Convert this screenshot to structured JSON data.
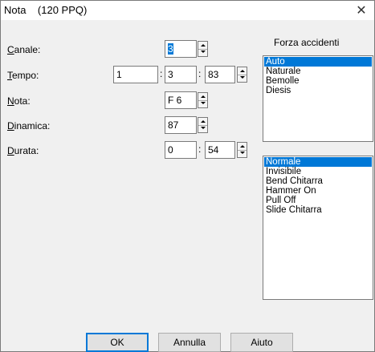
{
  "window": {
    "title": "Nota    (120 PPQ)",
    "close_glyph": "✕"
  },
  "fields": {
    "canale": {
      "label_u": "C",
      "label_rest": "anale:",
      "value": "3"
    },
    "tempo": {
      "label_u": "T",
      "label_rest": "empo:",
      "bar": "1",
      "beat": "3",
      "tick": "83"
    },
    "nota": {
      "label_u": "N",
      "label_rest": "ota:",
      "value": "F 6"
    },
    "dinamica": {
      "label_u": "D",
      "label_rest": "inamica:",
      "value": "87"
    },
    "durata": {
      "label_u": "D",
      "label_rest": "urata:",
      "beats": "0",
      "ticks": "54"
    }
  },
  "separator": ":",
  "accidents": {
    "title": "Forza accidenti",
    "items": [
      "Auto",
      "Naturale",
      "Bemolle",
      "Diesis"
    ],
    "selected": 0
  },
  "note_types": {
    "items": [
      "Normale",
      "Invisibile",
      "Bend Chitarra",
      "Hammer On",
      "Pull Off",
      "Slide Chitarra"
    ],
    "selected": 0
  },
  "buttons": {
    "ok": "OK",
    "cancel": "Annulla",
    "help": "Aiuto"
  },
  "colors": {
    "selection": "#0078d7",
    "background": "#f0f0f0"
  }
}
